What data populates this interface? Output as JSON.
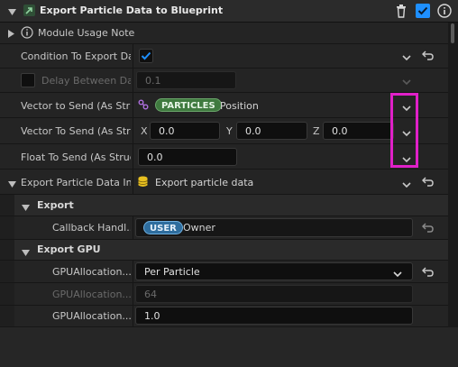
{
  "header": {
    "title": "Export Particle Data to Blueprint"
  },
  "rows": {
    "module_usage": {
      "label": "Module Usage Note"
    },
    "condition": {
      "label": "Condition To Export Dat"
    },
    "delay": {
      "label": "Delay Between Dat",
      "value": "0.1"
    },
    "vector_send_struct": {
      "label": "Vector to Send (As Stru",
      "badge": "PARTICLES",
      "value": "Position"
    },
    "vector_send": {
      "label": "Vector To Send (As Stru",
      "x_label": "X",
      "x_value": "0.0",
      "y_label": "Y",
      "y_value": "0.0",
      "z_label": "Z",
      "z_value": "0.0"
    },
    "float_send": {
      "label": "Float To Send (As Struc",
      "value": "0.0"
    },
    "export_interface": {
      "label": "Export Particle Data Int",
      "value": "Export particle data"
    },
    "export_section": {
      "label": "Export"
    },
    "callback": {
      "label": "Callback Handl...",
      "badge": "USER",
      "value": "Owner"
    },
    "export_gpu_section": {
      "label": "Export GPU"
    },
    "gpu_alloc_mode": {
      "label": "GPUAllocation...",
      "value": "Per Particle"
    },
    "gpu_alloc_count": {
      "label": "GPUAllocation...",
      "value": "64"
    },
    "gpu_alloc_scale": {
      "label": "GPUAllocation...",
      "value": "1.0"
    }
  },
  "colors": {
    "accent_blue": "#1e8fff",
    "highlight_magenta": "#e020c8",
    "badge_particles": "#3f7a3f",
    "badge_user": "#2e6d9e"
  }
}
